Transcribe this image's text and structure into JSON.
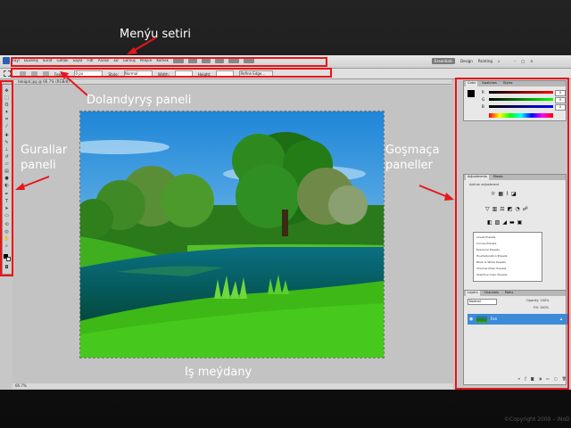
{
  "callouts": {
    "menu_bar": "Menýu setiri",
    "options_bar": "Dolandyryş paneli",
    "tools": "Gurallar\npaneli",
    "panels": "Goşmaça\npaneller",
    "workspace": "Iş meýdany"
  },
  "menubar": {
    "items": [
      "Faýl",
      "Düzediş",
      "Surat",
      "Gatlak",
      "Saýla",
      "Filtr",
      "Analiz",
      "3D",
      "Görnüş",
      "Penjire",
      "Kömek"
    ],
    "workspace_button": "Essentials",
    "right_items": [
      "Design",
      "Painting",
      "»"
    ]
  },
  "optionsbar": {
    "items": [
      "Feather:",
      "0 px",
      "Style:",
      "Normal",
      "Width:",
      "Height:",
      "Refine Edge..."
    ]
  },
  "tabbar": {
    "title": "tebigat.jpg @ 66.7% (RGB/8)"
  },
  "statusbar": {
    "zoom": "66.7%"
  },
  "panels": {
    "color_tabs": [
      "Color",
      "Swatches",
      "Styles"
    ],
    "rgb_labels": [
      "R",
      "G",
      "B"
    ],
    "rgb_values": [
      "0",
      "0",
      "0"
    ],
    "adjust_tabs": [
      "Adjustments",
      "Masks"
    ],
    "adjust_title": "Add an adjustment",
    "adjust_presets": [
      "Levels Presets",
      "Curves Presets",
      "Exposure Presets",
      "Hue/Saturation Presets",
      "Black & White Presets",
      "Channel Mixer Presets",
      "Selective Color Presets"
    ],
    "layers_tabs": [
      "Layers",
      "Channels",
      "Paths"
    ],
    "blend_mode": "Normal",
    "opacity_label": "Opacity: 100%",
    "fill_label": "Fill: 100%",
    "layer_name": "Fon"
  },
  "footer": {
    "copyright": "©Copyright 2009 – iNoD"
  },
  "colors": {
    "accent_red": "#e8151b",
    "selection_blue": "#3d8bd8",
    "background": "#1a1a1a"
  }
}
